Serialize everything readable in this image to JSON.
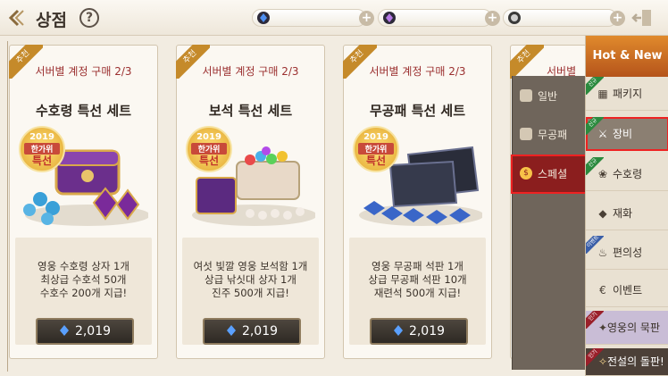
{
  "header": {
    "back_icon": "arrow-left-icon",
    "title": "상점",
    "help_label": "?",
    "currencies": [
      {
        "icon": "blue-gem-icon",
        "value": "",
        "plus": "+"
      },
      {
        "icon": "purple-gem-icon",
        "value": "",
        "plus": "+"
      },
      {
        "icon": "silver-coin-icon",
        "value": "",
        "plus": "+"
      }
    ],
    "exit_icon": "exit-door-icon"
  },
  "cards": [
    {
      "ribbon": "추천",
      "limit": "서버별 계정 구매 2/3",
      "name": "수호령 특선 세트",
      "badge": {
        "year": "2019",
        "line1": "한가위",
        "line2": "특선"
      },
      "desc": [
        "영웅 수호령 상자 1개",
        "최상급 수호석 50개",
        "수호수 200개 지급!"
      ],
      "price": "2,019",
      "art_colors": [
        "#6b2f8c",
        "#3aa0d8"
      ]
    },
    {
      "ribbon": "추천",
      "limit": "서버별 계정 구매 2/3",
      "name": "보석 특선 세트",
      "badge": {
        "year": "2019",
        "line1": "한가위",
        "line2": "특선"
      },
      "desc": [
        "여섯 빛깔 영웅 보석함 1개",
        "상급 낚싯대 상자 1개",
        "진주 500개 지급!"
      ],
      "price": "2,019",
      "art_colors": [
        "#5b2a80",
        "#e8d9c8"
      ]
    },
    {
      "ribbon": "추천",
      "limit": "서버별 계정 구매 2/3",
      "name": "무공패 특선 세트",
      "badge": {
        "year": "2019",
        "line1": "한가위",
        "line2": "특선"
      },
      "desc": [
        "영웅 무공패 석판 1개",
        "상급 무공패 석판 10개",
        "재련석 500개 지급!"
      ],
      "price": "2,019",
      "art_colors": [
        "#2a2d3a",
        "#3a66c8"
      ]
    },
    {
      "ribbon": "추천",
      "limit": "서버별"
    }
  ],
  "submenu": [
    {
      "label": "일반",
      "icon": "box-icon"
    },
    {
      "label": "무공패",
      "icon": "tablet-icon"
    },
    {
      "label": "스페셜",
      "icon": "special-coin-icon",
      "active": true
    }
  ],
  "sidebar": {
    "hot_new": "Hot & New",
    "hot_tag": "인기",
    "items": [
      {
        "label": "패키지",
        "icon": "package-icon",
        "tag": "신규",
        "tag_color": "#2b8a3e"
      },
      {
        "label": "장비",
        "icon": "equipment-icon",
        "tag": "신규",
        "tag_color": "#2b8a3e",
        "selected": true
      },
      {
        "label": "수호령",
        "icon": "paw-icon",
        "tag": "신규",
        "tag_color": "#2b8a3e"
      },
      {
        "label": "재화",
        "icon": "diamond-icon",
        "tag": "",
        "tag_color": ""
      },
      {
        "label": "편의성",
        "icon": "potion-icon",
        "tag": "이벤트",
        "tag_color": "#3b5fa8"
      },
      {
        "label": "이벤트",
        "icon": "event-coin-icon",
        "tag": "",
        "tag_color": ""
      },
      {
        "label": "영웅의 묵판",
        "icon": "hero-tablet-icon",
        "tag": "인기",
        "tag_color": "#9a1f2a"
      },
      {
        "label": "전설의 돌판!",
        "icon": "legend-icon",
        "tag": "인기",
        "tag_color": "#9a1f2a"
      }
    ]
  }
}
